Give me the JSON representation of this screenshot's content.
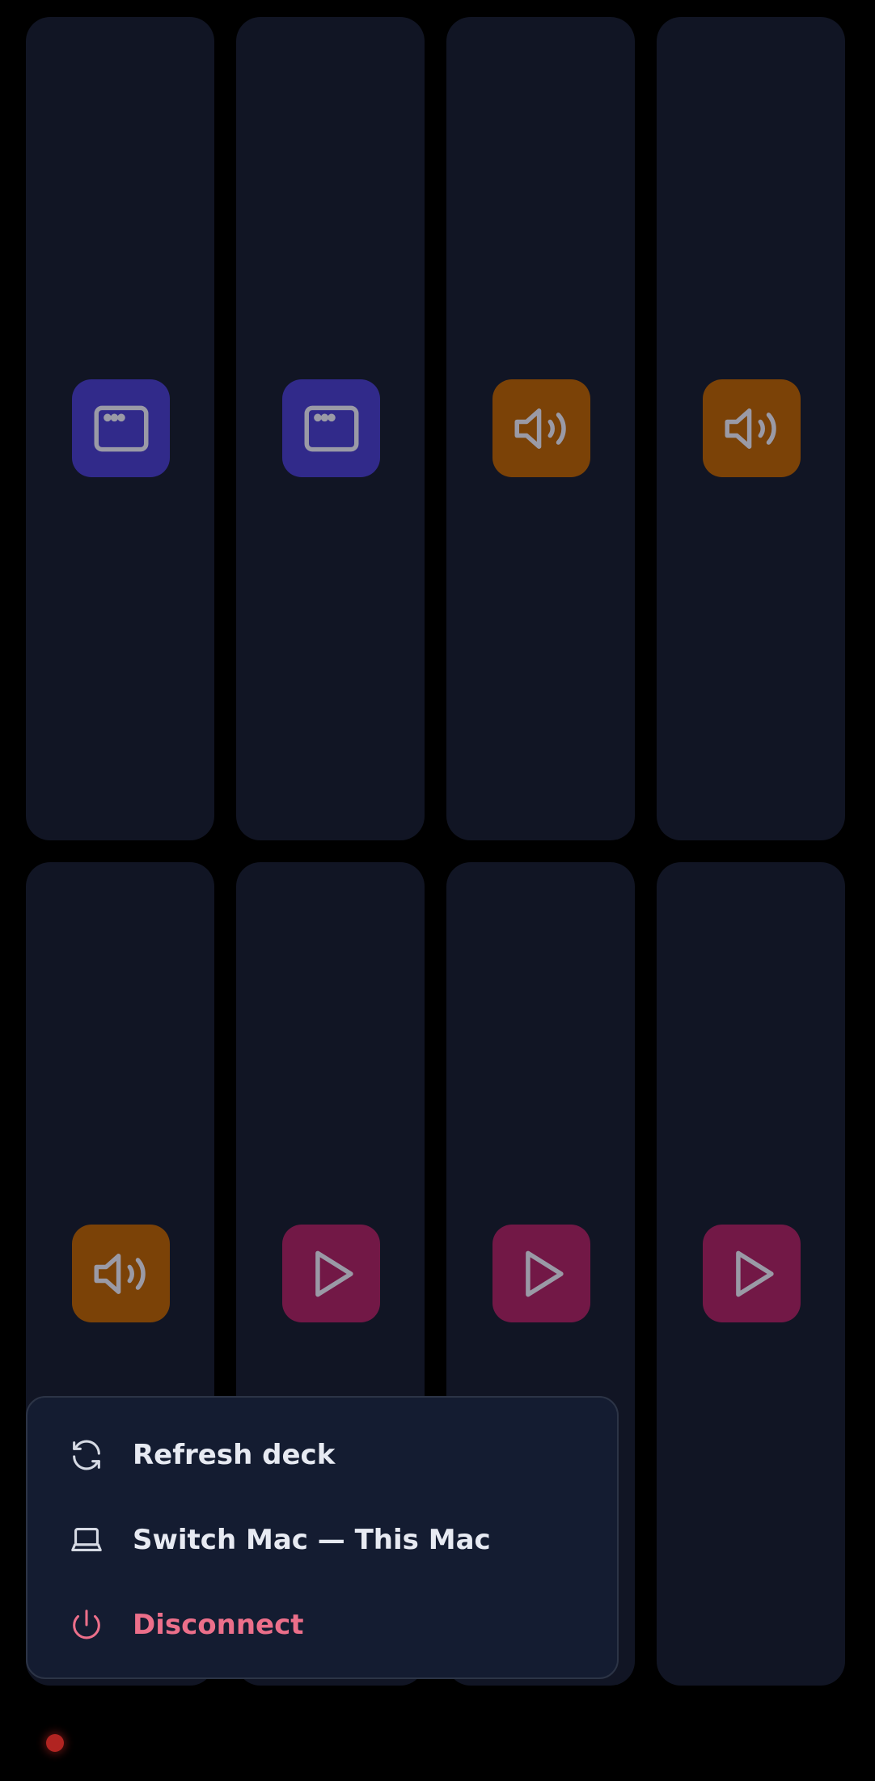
{
  "deck": {
    "tiles": [
      {
        "icon": "app-window-icon",
        "color": "#312a8a"
      },
      {
        "icon": "app-window-icon",
        "color": "#312a8a"
      },
      {
        "icon": "volume-icon",
        "color": "#7b4207"
      },
      {
        "icon": "volume-icon",
        "color": "#7b4207"
      },
      {
        "icon": "volume-icon",
        "color": "#7b4207"
      },
      {
        "icon": "play-icon",
        "color": "#721846"
      },
      {
        "icon": "play-icon",
        "color": "#721846"
      },
      {
        "icon": "play-icon",
        "color": "#721846"
      }
    ]
  },
  "menu": {
    "refresh_label": "Refresh deck",
    "switch_label": "Switch Mac — This Mac",
    "disconnect_label": "Disconnect"
  },
  "colors": {
    "background": "#000000",
    "tile": "#111524",
    "menu_bg": "#141c31",
    "danger": "#ec6f8a",
    "status": "#b12421"
  },
  "status": {
    "icon": "status-dot-icon",
    "state_color": "#b12421"
  }
}
